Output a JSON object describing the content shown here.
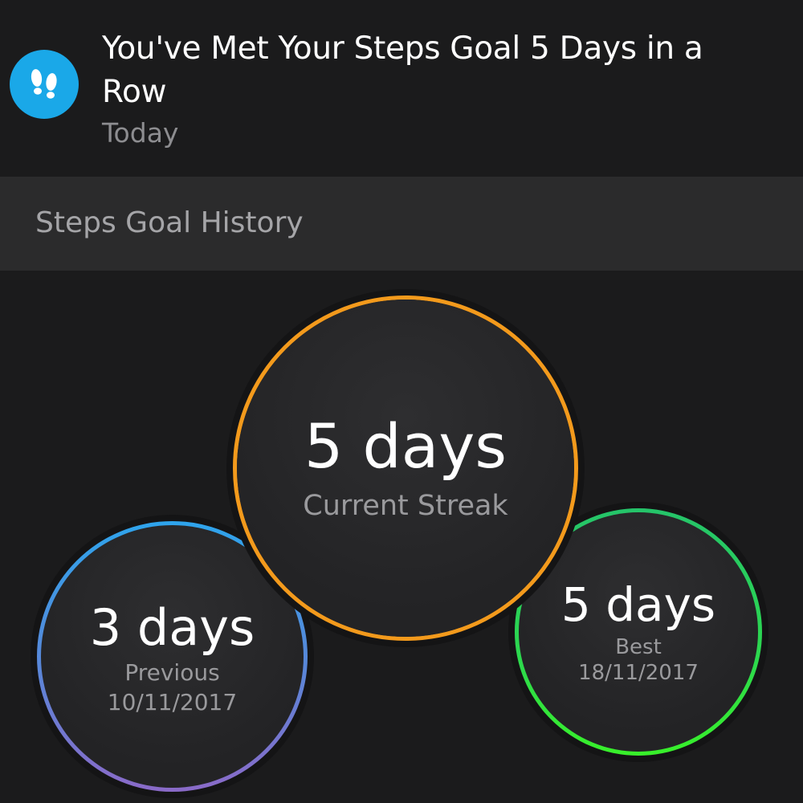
{
  "notification": {
    "icon": "footprints-icon",
    "icon_color": "#1aa8e8",
    "title": "You've Met Your Steps Goal 5 Days in a Row",
    "time": "Today"
  },
  "section": {
    "title": "Steps Goal History"
  },
  "streaks": {
    "current": {
      "value": "5 days",
      "label": "Current Streak",
      "ring_color": "#f39a1c"
    },
    "previous": {
      "value": "3 days",
      "label": "Previous",
      "date": "10/11/2017",
      "ring_color": "#2ea4ec"
    },
    "best": {
      "value": "5 days",
      "label": "Best",
      "date": "18/11/2017",
      "ring_color": "#2cd84e"
    }
  }
}
